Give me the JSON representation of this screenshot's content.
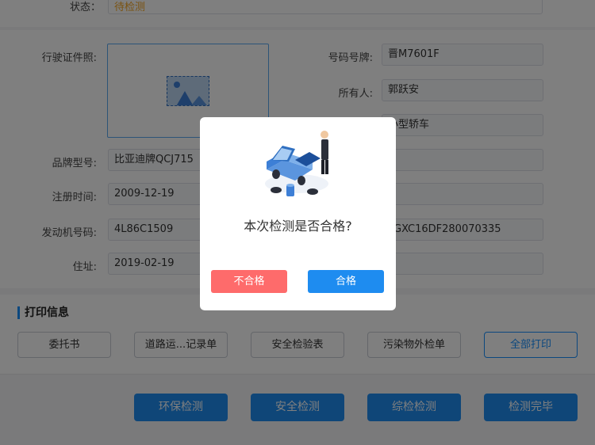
{
  "status": {
    "label": "状态：",
    "value": "待检测"
  },
  "vehicle": {
    "license_photo_label": "行驶证件照:",
    "brand_model_label": "品牌型号:",
    "brand_model_value": "比亚迪牌QCJ715",
    "reg_date_label": "注册时间:",
    "reg_date_value": "2009-12-19",
    "engine_no_label": "发动机号码:",
    "engine_no_value": "4L86C1509",
    "address_label": "住址:",
    "address_value": "2019-02-19",
    "plate_label": "号码号牌:",
    "plate_value": "晋M7601F",
    "owner_label": "所有人:",
    "owner_value": "郭跃安",
    "vehicle_type_value": "小型轿车",
    "vin_value": "GXC16DF280070335"
  },
  "print_section": {
    "title": "打印信息",
    "buttons": [
      "委托书",
      "道路运...记录单",
      "安全检验表",
      "污染物外检单",
      "全部打印"
    ]
  },
  "actions": [
    "环保检测",
    "安全检测",
    "综检检测",
    "检测完毕"
  ],
  "dialog": {
    "message": "本次检测是否合格?",
    "fail_label": "不合格",
    "pass_label": "合格"
  },
  "colors": {
    "primary": "#1e8cf0",
    "danger": "#fe6b6b",
    "pending": "#f5a623"
  }
}
